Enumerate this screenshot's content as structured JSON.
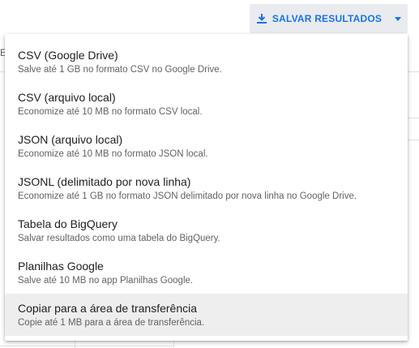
{
  "toolbar": {
    "save_label": "SALVAR RESULTADOS",
    "accent_color": "#1a73e8"
  },
  "background": {
    "fragment_text": "E("
  },
  "menu": {
    "items": [
      {
        "title": "CSV (Google Drive)",
        "description": "Salve até 1 GB no formato CSV no Google Drive."
      },
      {
        "title": "CSV (arquivo local)",
        "description": "Economize até 10 MB no formato CSV local."
      },
      {
        "title": "JSON (arquivo local)",
        "description": "Economize até 10 MB no formato JSON local."
      },
      {
        "title": "JSONL (delimitado por nova linha)",
        "description": "Economize até 1 GB no formato JSON delimitado por nova linha no Google Drive."
      },
      {
        "title": "Tabela do BigQuery",
        "description": "Salvar resultados como uma tabela do BigQuery."
      },
      {
        "title": "Planilhas Google",
        "description": "Salve até 10 MB no app Planilhas Google."
      },
      {
        "title": "Copiar para a área de transferência",
        "description": "Copie até 1 MB para a área de transferência."
      }
    ]
  }
}
